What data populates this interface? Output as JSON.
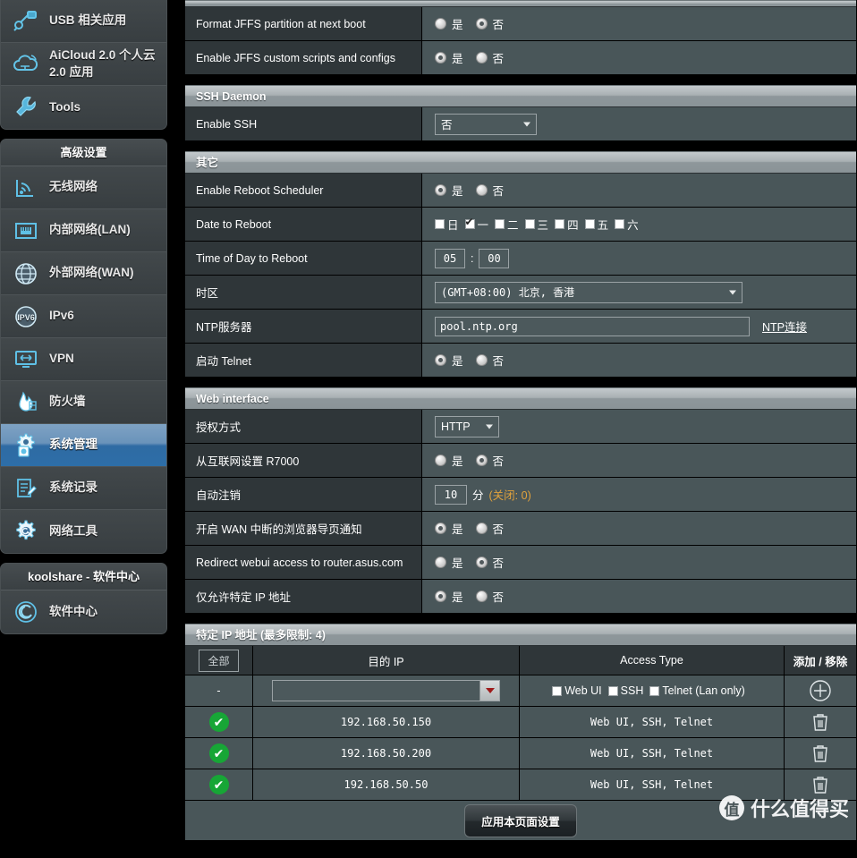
{
  "sidebar": {
    "top_group": {
      "items": [
        {
          "label": "USB 相关应用",
          "icon": "usb-icon"
        },
        {
          "label": "AiCloud 2.0 个人云 2.0 应用",
          "icon": "cloud-icon"
        },
        {
          "label": "Tools",
          "icon": "wrench-icon"
        }
      ]
    },
    "advanced_group": {
      "title": "高级设置",
      "items": [
        {
          "label": "无线网络",
          "icon": "wifi-icon",
          "selected": false
        },
        {
          "label": "内部网络(LAN)",
          "icon": "lan-port-icon",
          "selected": false
        },
        {
          "label": "外部网络(WAN)",
          "icon": "globe-icon",
          "selected": false
        },
        {
          "label": "IPv6",
          "icon": "ipv6-globe-icon",
          "selected": false
        },
        {
          "label": "VPN",
          "icon": "monitor-icon",
          "selected": false
        },
        {
          "label": "防火墙",
          "icon": "flame-icon",
          "selected": false
        },
        {
          "label": "系统管理",
          "icon": "gear-person-icon",
          "selected": true
        },
        {
          "label": "系统记录",
          "icon": "log-pencil-icon",
          "selected": false
        },
        {
          "label": "网络工具",
          "icon": "gear-wrench-icon",
          "selected": false
        }
      ]
    },
    "koolshare_group": {
      "title": "koolshare - 软件中心",
      "items": [
        {
          "label": "软件中心",
          "icon": "debian-swirl-icon"
        }
      ]
    }
  },
  "main": {
    "jffs_rows": [
      {
        "label": "Format JFFS partition at next boot",
        "yes_label": "是",
        "no_label": "否",
        "selected": "no"
      },
      {
        "label": "Enable JFFS custom scripts and configs",
        "yes_label": "是",
        "no_label": "否",
        "selected": "yes"
      }
    ],
    "ssh_section": {
      "title": "SSH Daemon",
      "enable_ssh": {
        "label": "Enable SSH",
        "value": "否"
      }
    },
    "other_section": {
      "title": "其它",
      "reboot_scheduler": {
        "label": "Enable Reboot Scheduler",
        "yes_label": "是",
        "no_label": "否",
        "selected": "yes"
      },
      "date_to_reboot": {
        "label": "Date to Reboot",
        "days": [
          {
            "label": "日",
            "checked": false
          },
          {
            "label": "一",
            "checked": true
          },
          {
            "label": "二",
            "checked": false
          },
          {
            "label": "三",
            "checked": false
          },
          {
            "label": "四",
            "checked": false
          },
          {
            "label": "五",
            "checked": false
          },
          {
            "label": "六",
            "checked": false
          }
        ]
      },
      "time_of_day": {
        "label": "Time of Day to Reboot",
        "hour": "05",
        "separator": ":",
        "minute": "00"
      },
      "timezone": {
        "label": "时区",
        "value": "(GMT+08:00) 北京, 香港"
      },
      "ntp_server": {
        "label": "NTP服务器",
        "value": "pool.ntp.org",
        "link_label": "NTP连接"
      },
      "telnet": {
        "label": "启动 Telnet",
        "yes_label": "是",
        "no_label": "否",
        "selected": "yes"
      }
    },
    "web_interface": {
      "title": "Web interface",
      "auth_method": {
        "label": "授权方式",
        "value": "HTTP"
      },
      "wan_setup": {
        "label": "从互联网设置 R7000",
        "yes_label": "是",
        "no_label": "否",
        "selected": "no"
      },
      "auto_logout": {
        "label": "自动注销",
        "value": "10",
        "unit": "分",
        "hint": "(关闭: 0)"
      },
      "wan_notify": {
        "label": "开启 WAN 中断的浏览器导页通知",
        "yes_label": "是",
        "no_label": "否",
        "selected": "yes"
      },
      "redirect_webui": {
        "label": "Redirect webui access to router.asus.com",
        "yes_label": "是",
        "no_label": "否",
        "selected": "no"
      },
      "only_specified_ip": {
        "label": "仅允许特定 IP 地址",
        "yes_label": "是",
        "no_label": "否",
        "selected": "yes"
      }
    },
    "ip_table": {
      "title": "特定 IP 地址 (最多限制: 4)",
      "headers": {
        "all": "全部",
        "dest_ip": "目的 IP",
        "access_type": "Access Type",
        "add_remove": "添加 / 移除"
      },
      "input_row": {
        "marker": "-",
        "ip_value": "",
        "access_checkboxes": [
          {
            "label": "Web UI",
            "checked": false
          },
          {
            "label": "SSH",
            "checked": false
          },
          {
            "label": "Telnet (Lan only)",
            "checked": false
          }
        ],
        "add_icon": "plus-circle-icon"
      },
      "rows": [
        {
          "status": "enabled",
          "ip": "192.168.50.150",
          "access": "Web UI, SSH, Telnet",
          "delete_icon": "trash-icon"
        },
        {
          "status": "enabled",
          "ip": "192.168.50.200",
          "access": "Web UI, SSH, Telnet",
          "delete_icon": "trash-icon"
        },
        {
          "status": "enabled",
          "ip": "192.168.50.50",
          "access": "Web UI, SSH, Telnet",
          "delete_icon": "trash-icon"
        }
      ]
    },
    "apply_button": "应用本页面设置"
  },
  "watermark": {
    "mark": "值",
    "text": "什么值得买"
  },
  "colors": {
    "accent_blue": "#2f6ba3",
    "panel_value_bg": "#495659",
    "panel_label_bg": "#2f3639",
    "status_green": "#17a636",
    "hint_orange": "#e2a33c",
    "dropdown_red": "#9e1b1b"
  }
}
